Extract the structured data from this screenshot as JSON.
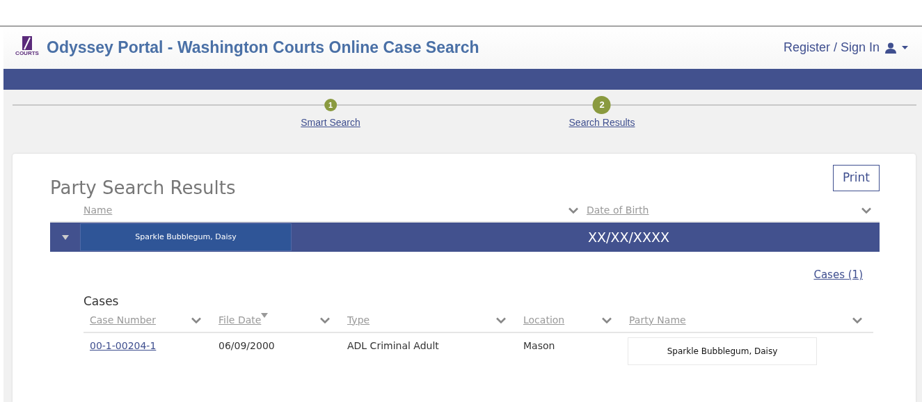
{
  "header": {
    "logo_text": "COURTS",
    "title": "Odyssey Portal - Washington Courts Online Case Search",
    "sign_in": "Register / Sign In"
  },
  "steps": [
    {
      "number": "1",
      "label": "Smart Search",
      "selected": false
    },
    {
      "number": "2",
      "label": "Search Results",
      "selected": true
    }
  ],
  "results": {
    "title": "Party Search Results",
    "print_button": "Print",
    "columns": [
      {
        "label": "Name"
      },
      {
        "label": "Date of Birth"
      }
    ],
    "rows": [
      {
        "name": "Sparkle Bubblegum, Daisy",
        "dob": "XX/XX/XXXX",
        "expanded": true,
        "cases_link": "Cases (1)",
        "cases": {
          "title": "Cases",
          "columns": [
            {
              "label": "Case Number",
              "sorted": false
            },
            {
              "label": "File Date",
              "sorted": true
            },
            {
              "label": "Type",
              "sorted": false
            },
            {
              "label": "Location",
              "sorted": false
            },
            {
              "label": "Party Name",
              "sorted": false
            }
          ],
          "rows": [
            {
              "case_number": "00-1-00204-1",
              "file_date": "06/09/2000",
              "type": "ADL Criminal Adult",
              "location": "Mason",
              "party_name": "Sparkle Bubblegum, Daisy"
            }
          ]
        }
      }
    ]
  }
}
